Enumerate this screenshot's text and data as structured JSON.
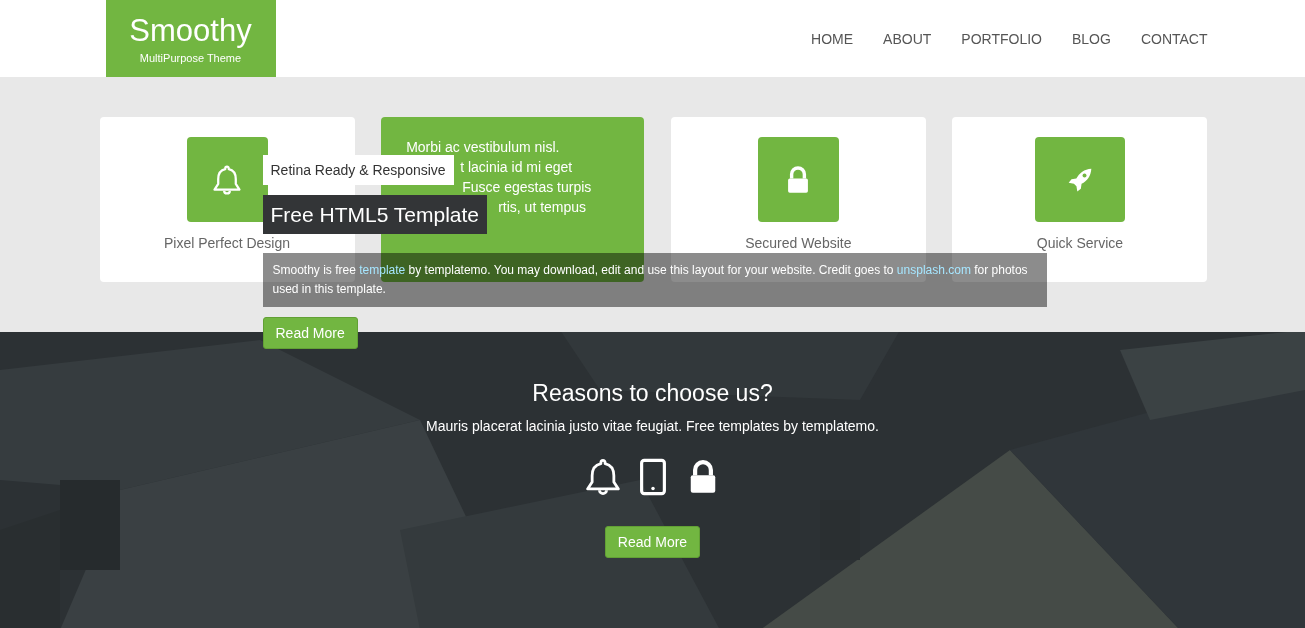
{
  "header": {
    "logo": {
      "title": "Smoothy",
      "tagline": "MultiPurpose Theme"
    },
    "nav": [
      {
        "label": "HOME"
      },
      {
        "label": "ABOUT"
      },
      {
        "label": "PORTFOLIO"
      },
      {
        "label": "BLOG"
      },
      {
        "label": "CONTACT"
      }
    ]
  },
  "features": [
    {
      "kind": "icon",
      "title": "Pixel Perfect Design"
    },
    {
      "kind": "text",
      "lines": [
        "Morbi ac vestibulum nisl.",
        "t lacinia id mi eget",
        "Fusce egestas turpis",
        "rtis, ut tempus"
      ]
    },
    {
      "kind": "icon",
      "title": "Secured Website"
    },
    {
      "kind": "icon",
      "title": "Quick Service"
    }
  ],
  "slide_caption": {
    "subtitle": "Retina Ready & Responsive",
    "title": "Free HTML5 Template",
    "description": [
      {
        "kind": "text",
        "text": "Smoothy is free "
      },
      {
        "kind": "link",
        "text": "template"
      },
      {
        "kind": "text",
        "text": " by templatemo. You may download, edit and use this layout for your website. Credit goes to "
      },
      {
        "kind": "link",
        "text": "unsplash.com"
      },
      {
        "kind": "text",
        "text": " for photos used in this template."
      }
    ],
    "button": "Read More"
  },
  "reasons": {
    "title": "Reasons to choose us?",
    "subtitle": "Mauris placerat lacinia justo vitae feugiat. Free templates by templatemo.",
    "button": "Read More"
  }
}
